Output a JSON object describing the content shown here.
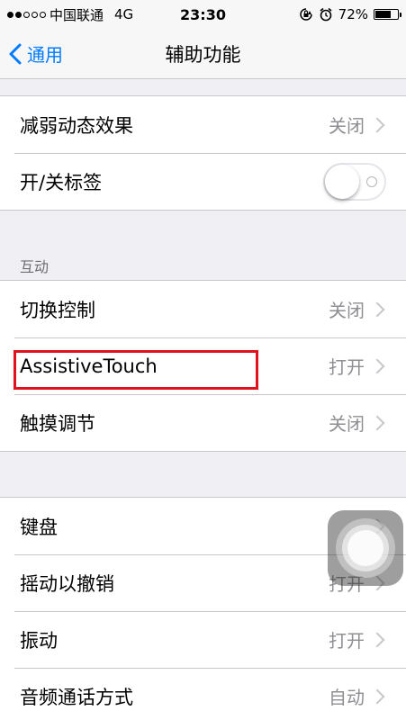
{
  "status_bar": {
    "carrier": "中国联通",
    "network": "4G",
    "time": "23:30",
    "battery_text": "72%",
    "battery_level": 0.72,
    "signal_bars_filled": 2,
    "signal_bars_total": 5,
    "icons": [
      "orientation-lock-icon",
      "alarm-icon",
      "battery-icon"
    ]
  },
  "nav": {
    "back_label": "通用",
    "title": "辅助功能"
  },
  "group1": {
    "rows": [
      {
        "label": "减弱动态效果",
        "value": "关闭"
      },
      {
        "label": "开/关标签",
        "toggle": false
      }
    ]
  },
  "section_interaction": {
    "header": "互动",
    "rows": [
      {
        "label": "切换控制",
        "value": "关闭"
      },
      {
        "label": "AssistiveTouch",
        "value": "打开"
      },
      {
        "label": "触摸调节",
        "value": "关闭"
      }
    ]
  },
  "group3": {
    "rows": [
      {
        "label": "键盘",
        "value": ""
      },
      {
        "label": "摇动以撤销",
        "value": "打开"
      },
      {
        "label": "振动",
        "value": "打开"
      },
      {
        "label": "音频通话方式",
        "value": "自动"
      }
    ]
  },
  "colors": {
    "accent": "#007aff",
    "highlight": "#e0121e",
    "background": "#efeff4",
    "secondary_text": "#8e8e93"
  }
}
